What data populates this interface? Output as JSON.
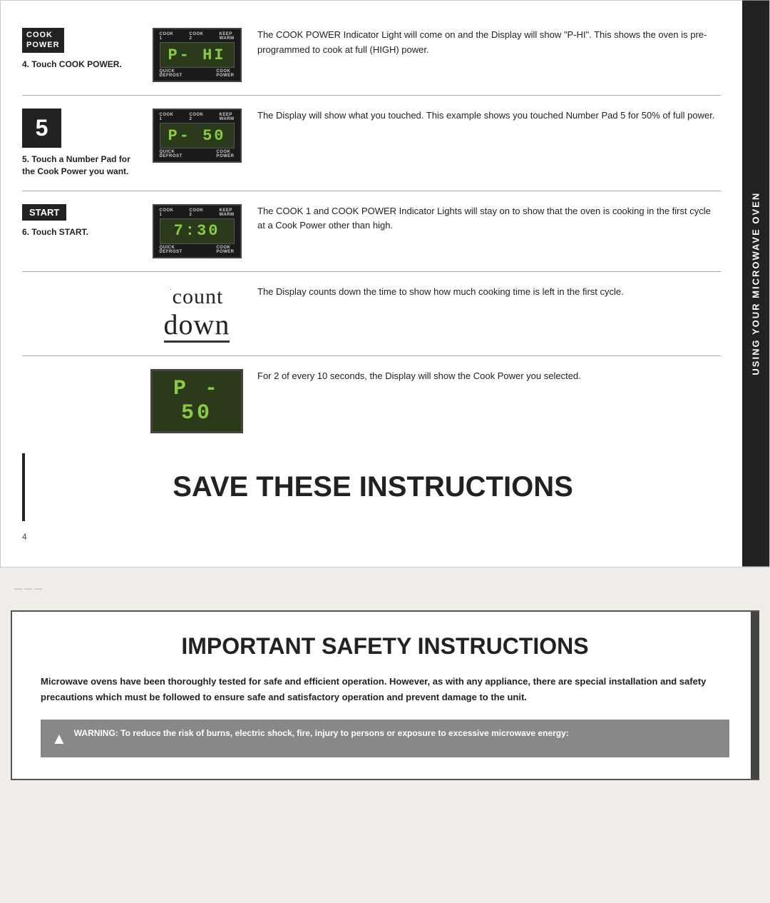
{
  "side_tab": {
    "label": "USING YOUR MICROWAVE OVEN"
  },
  "steps": [
    {
      "id": "step4",
      "badge": "COOK\nPOWER",
      "step_label": "4. Touch COOK POWER.",
      "display_text": "P - H I",
      "description": "The COOK POWER Indicator Light will come on and the Display will show \"P-HI\". This shows the oven is pre-programmed to cook at full (HIGH) power."
    },
    {
      "id": "step5",
      "number": "5",
      "step_label": "5. Touch a Number Pad for the Cook Power you want.",
      "display_text": "P - 5 0",
      "description": "The Display will show what you touched. This example shows you touched Number Pad 5 for 50% of full power."
    },
    {
      "id": "step6",
      "badge": "START",
      "step_label": "6. Touch START.",
      "display_text": "7 : 3 0",
      "description": "The COOK 1 and COOK POWER Indicator Lights will stay on to show that the oven is cooking in the first cycle at a Cook Power other than high."
    },
    {
      "id": "countdown",
      "display_type": "countdown",
      "display_word_top": "count",
      "display_word_bottom": "down",
      "description": "The Display counts down the time to show how much cooking time is left in the first cycle."
    },
    {
      "id": "p50",
      "display_type": "p50",
      "display_text": "P - 5 0",
      "description": "For 2 of every 10 seconds, the Display will show the Cook Power you selected."
    }
  ],
  "save_instructions": {
    "title": "SAVE THESE INSTRUCTIONS"
  },
  "page_number": "4",
  "safety": {
    "title": "IMPORTANT SAFETY INSTRUCTIONS",
    "intro": "Microwave ovens have been thoroughly tested for safe and efficient operation. However, as with any appliance, there are special installation and safety precautions which must be followed to ensure safe and satisfactory operation and prevent damage to the unit.",
    "warning_label": "WARNING:",
    "warning_text": "To reduce the risk of burns, electric shock, fire, injury to persons or exposure to excessive microwave energy:"
  },
  "display_labels": {
    "cook1": "COOK\n1",
    "cook2": "COOK\n2",
    "keep_warm": "KEEP\nWARM",
    "quick_defrost": "QUICK\nDEFROST",
    "cook_power": "COOK\nPOWER"
  }
}
